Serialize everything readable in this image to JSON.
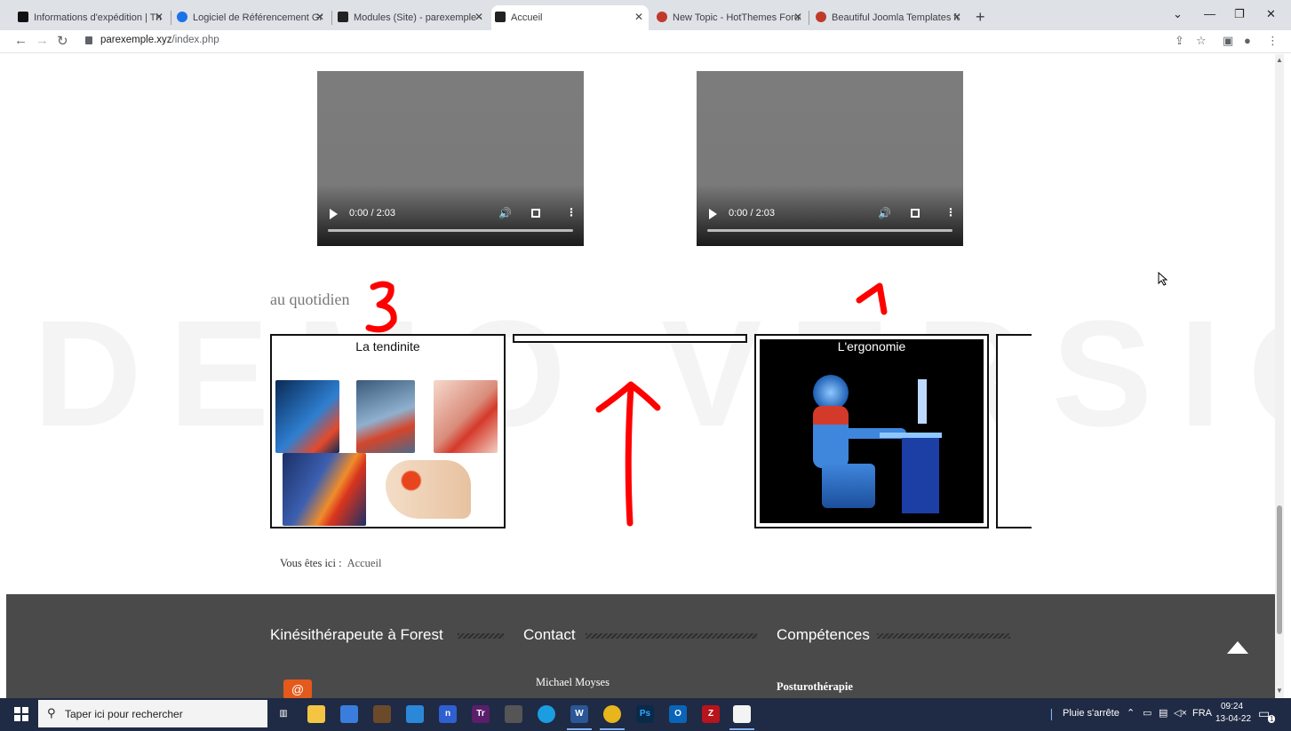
{
  "browser": {
    "tabs": [
      {
        "title": "Informations d'expédition | Thule",
        "icon": "thule-icon",
        "color": "#111111"
      },
      {
        "title": "Logiciel de Référencement Gr",
        "icon": "cloud-icon",
        "color": "#1a73e8"
      },
      {
        "title": "Modules (Site) - parexemple - Ad",
        "icon": "joomla-icon",
        "color": "#222222"
      },
      {
        "title": "Accueil",
        "icon": "site-icon",
        "color": "#222222"
      },
      {
        "title": "New Topic - HotThemes Forum -",
        "icon": "hotthemes-icon",
        "color": "#c0392b"
      },
      {
        "title": "Beautiful Joomla Templates for M",
        "icon": "hotthemes-icon",
        "color": "#c0392b"
      }
    ],
    "active_tab": 3,
    "url_host": "parexemple.xyz",
    "url_path": "/index.php",
    "window_controls": {
      "minimize": "—",
      "restore": "❐",
      "close": "✕",
      "tab_list": "⌄",
      "new_tab": "+"
    }
  },
  "page": {
    "videos": [
      {
        "time": "0:00 / 2:03"
      },
      {
        "time": "0:00 / 2:03"
      }
    ],
    "watermark": "DEMO VERSION",
    "section_title": "au quotidien",
    "cards": [
      {
        "title": "La tendinite"
      },
      {
        "title": ""
      },
      {
        "title": "L'ergonomie"
      }
    ],
    "annotations": {
      "left": "3",
      "right": "1"
    },
    "breadcrumb": {
      "label": "Vous êtes ici :",
      "link": "Accueil"
    },
    "footer": {
      "col1_heading": "Kinésithérapeute à Forest",
      "col2_heading": "Contact",
      "col3_heading": "Compétences",
      "contact_name": "Michael Moyses",
      "skill_1": "Posturothérapie"
    },
    "colors": {
      "footer_bg": "#4a4a4a",
      "annotation_red": "#ff0000"
    }
  },
  "taskbar": {
    "search_placeholder": "Taper ici pour rechercher",
    "weather": "Pluie s'arrête",
    "language": "FRA",
    "time": "09:24",
    "date": "13-04-22",
    "notification_count": "1"
  }
}
